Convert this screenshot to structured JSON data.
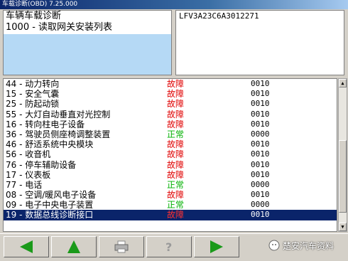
{
  "window": {
    "title": "车载诊断(OBD) 7.25.000"
  },
  "header": {
    "line1": "车辆车载诊断",
    "line2": "1000 - 读取网关安装列表",
    "vin": "LFV3A23C6A3012271"
  },
  "modules": [
    {
      "name": "44 - 动力转向",
      "status": "故障",
      "code": "0010",
      "state": "fault"
    },
    {
      "name": "15 - 安全气囊",
      "status": "故障",
      "code": "0010",
      "state": "fault"
    },
    {
      "name": "25 - 防起动锁",
      "status": "故障",
      "code": "0010",
      "state": "fault"
    },
    {
      "name": "55 - 大灯自动垂直对光控制",
      "status": "故障",
      "code": "0010",
      "state": "fault"
    },
    {
      "name": "16 - 转向柱电子设备",
      "status": "故障",
      "code": "0010",
      "state": "fault"
    },
    {
      "name": "36 - 驾驶员侧座椅调整装置",
      "status": "正常",
      "code": "0000",
      "state": "ok"
    },
    {
      "name": "46 - 舒适系统中央模块",
      "status": "故障",
      "code": "0010",
      "state": "fault"
    },
    {
      "name": "56 - 收音机",
      "status": "故障",
      "code": "0010",
      "state": "fault"
    },
    {
      "name": "76 - 停车辅助设备",
      "status": "故障",
      "code": "0010",
      "state": "fault"
    },
    {
      "name": "17 - 仪表板",
      "status": "故障",
      "code": "0010",
      "state": "fault"
    },
    {
      "name": "77 - 电话",
      "status": "正常",
      "code": "0000",
      "state": "ok"
    },
    {
      "name": "08 - 空调/暖风电子设备",
      "status": "故障",
      "code": "0010",
      "state": "fault"
    },
    {
      "name": "09 - 电子中央电子装置",
      "status": "正常",
      "code": "0000",
      "state": "ok"
    },
    {
      "name": "19 - 数据总线诊断接口",
      "status": "故障",
      "code": "0010",
      "state": "fault",
      "selected": true
    }
  ],
  "toolbar": {
    "buttons": [
      {
        "name": "back-button",
        "icon": "arrow-left-icon"
      },
      {
        "name": "up-button",
        "icon": "arrow-up-icon"
      },
      {
        "name": "print-button",
        "icon": "printer-icon"
      },
      {
        "name": "help-button",
        "icon": "question-icon"
      },
      {
        "name": "next-button",
        "icon": "arrow-right-icon"
      }
    ]
  },
  "watermark": {
    "text": "楚安汽车资料"
  },
  "colors": {
    "fault": "#e00000",
    "ok": "#00b000",
    "selection": "#0a246a",
    "arrow": "#1a9a1a"
  }
}
